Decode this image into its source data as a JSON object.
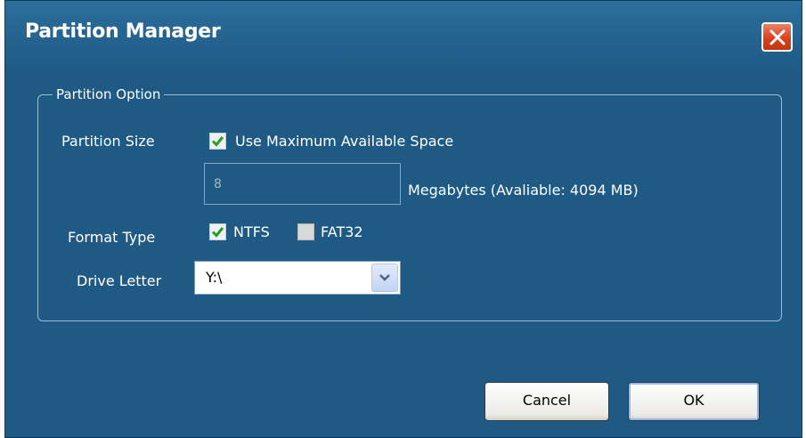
{
  "window": {
    "title": "Partition Manager",
    "close_icon": "close-icon"
  },
  "group": {
    "legend": "Partition Option"
  },
  "partition_size": {
    "label": "Partition Size",
    "use_max_checkbox": {
      "label": "Use Maximum Available Space",
      "checked": true
    },
    "size_input_value": "8",
    "size_input_enabled": false,
    "unit_text": "Megabytes (Avaliable: 4094 MB)"
  },
  "format_type": {
    "label": "Format Type",
    "options": [
      {
        "label": "NTFS",
        "checked": true
      },
      {
        "label": "FAT32",
        "checked": false
      }
    ]
  },
  "drive_letter": {
    "label": "Drive Letter",
    "selected": "Y:\\"
  },
  "buttons": {
    "cancel": "Cancel",
    "ok": "OK"
  },
  "colors": {
    "dialog_background": "#1e5a84",
    "title_text": "#ffffff",
    "close_button": "#d9431c",
    "checkmark": "#21a121"
  }
}
